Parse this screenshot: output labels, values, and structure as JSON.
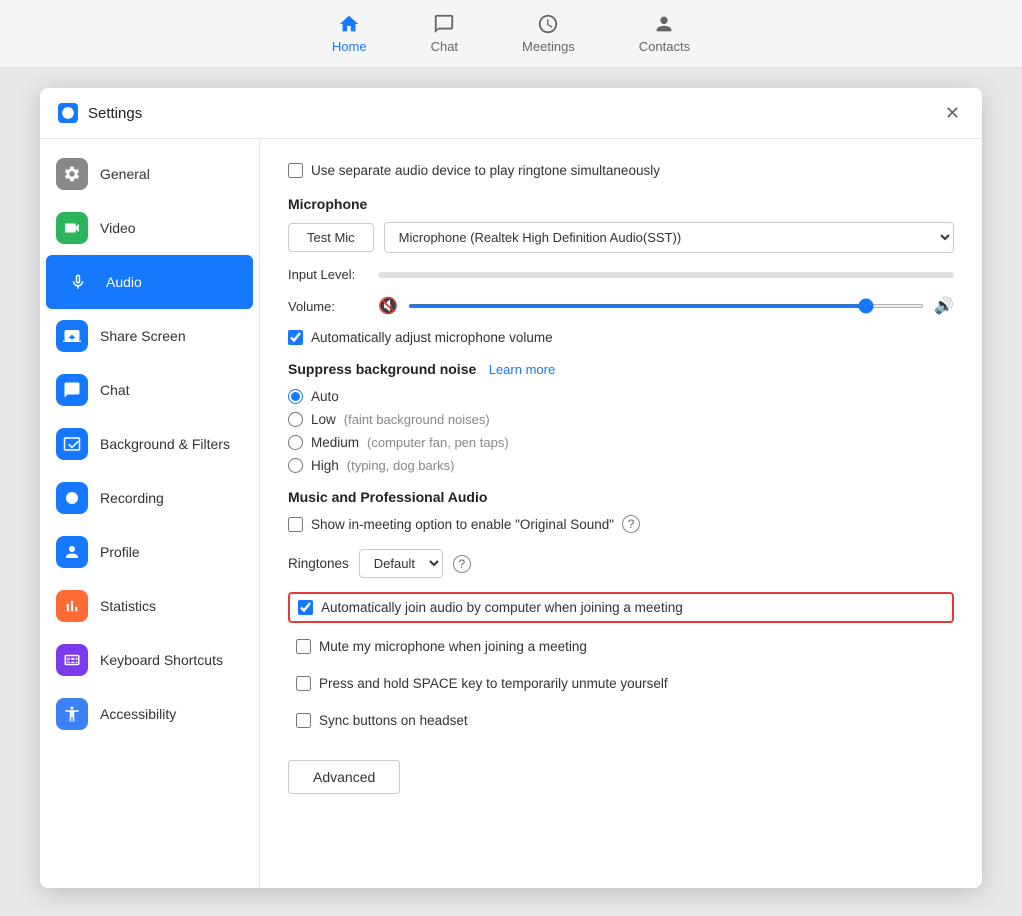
{
  "nav": {
    "items": [
      {
        "id": "home",
        "label": "Home",
        "active": true
      },
      {
        "id": "chat",
        "label": "Chat",
        "active": false
      },
      {
        "id": "meetings",
        "label": "Meetings",
        "active": false
      },
      {
        "id": "contacts",
        "label": "Contacts",
        "active": false
      }
    ]
  },
  "settings": {
    "title": "Settings",
    "close_label": "✕",
    "sidebar": {
      "items": [
        {
          "id": "general",
          "label": "General",
          "active": false
        },
        {
          "id": "video",
          "label": "Video",
          "active": false
        },
        {
          "id": "audio",
          "label": "Audio",
          "active": true
        },
        {
          "id": "share-screen",
          "label": "Share Screen",
          "active": false
        },
        {
          "id": "chat",
          "label": "Chat",
          "active": false
        },
        {
          "id": "background-filters",
          "label": "Background & Filters",
          "active": false
        },
        {
          "id": "recording",
          "label": "Recording",
          "active": false
        },
        {
          "id": "profile",
          "label": "Profile",
          "active": false
        },
        {
          "id": "statistics",
          "label": "Statistics",
          "active": false
        },
        {
          "id": "keyboard-shortcuts",
          "label": "Keyboard Shortcuts",
          "active": false
        },
        {
          "id": "accessibility",
          "label": "Accessibility",
          "active": false
        }
      ]
    },
    "content": {
      "separate_audio_label": "Use separate audio device to play ringtone simultaneously",
      "microphone_section": "Microphone",
      "test_mic_label": "Test Mic",
      "mic_device": "Microphone (Realtek High Definition Audio(SST))",
      "input_level_label": "Input Level:",
      "volume_label": "Volume:",
      "auto_adjust_label": "Automatically adjust microphone volume",
      "suppress_noise_label": "Suppress background noise",
      "learn_more_label": "Learn more",
      "noise_options": [
        {
          "id": "auto",
          "label": "Auto",
          "checked": true,
          "desc": ""
        },
        {
          "id": "low",
          "label": "Low",
          "checked": false,
          "desc": "(faint background noises)"
        },
        {
          "id": "medium",
          "label": "Medium",
          "checked": false,
          "desc": "(computer fan, pen taps)"
        },
        {
          "id": "high",
          "label": "High",
          "checked": false,
          "desc": "(typing, dog barks)"
        }
      ],
      "music_section": "Music and Professional Audio",
      "original_sound_label": "Show in-meeting option to enable \"Original Sound\"",
      "ringtones_label": "Ringtones",
      "ringtones_value": "Default",
      "auto_join_label": "Automatically join audio by computer when joining a meeting",
      "mute_mic_label": "Mute my microphone when joining a meeting",
      "press_hold_label": "Press and hold SPACE key to temporarily unmute yourself",
      "sync_buttons_label": "Sync buttons on headset",
      "advanced_label": "Advanced"
    }
  }
}
